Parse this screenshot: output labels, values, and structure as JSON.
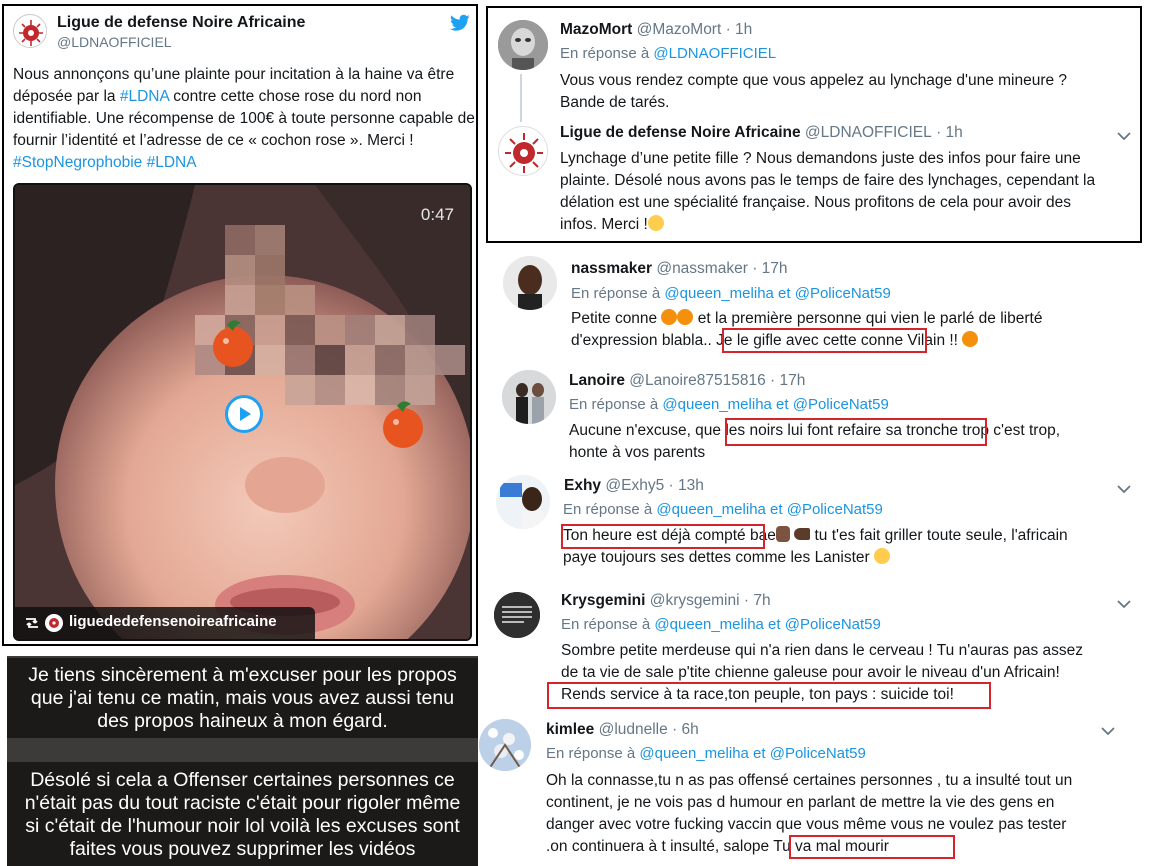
{
  "left_tweet": {
    "name": "Ligue de defense Noire Africaine",
    "handle": "@LDNAOFFICIEL",
    "text_part1": "Nous annonçons qu’une plainte pour incitation à la haine va être déposée par la ",
    "hashtag_ldna": "#LDNA",
    "text_part2": " contre cette chose rose du nord non identifiable. Une récompense de 100€ à toute personne capable de fournir l’identité et l’adresse de ce « cochon rose ». Merci !",
    "hashtags_end": "#StopNegrophobie #LDNA",
    "video_duration": "0:47",
    "video_account": "liguededefensenoireafricaine",
    "icon_bird": "twitter-bird-icon",
    "icon_retweet": "retweet-icon",
    "icon_play": "play-icon"
  },
  "apology": {
    "lines": [
      "Je tiens sincèrement à m'excuser pour les propos",
      "que j'ai tenu ce matin, mais vous avez aussi tenu",
      "des propos haineux à mon égard.",
      "Désolé si cela a Offenser certaines personnes ce",
      "n'était pas du tout raciste c'était pour rigoler même",
      "si c'était de l'humour noir lol voilà les excuses sont",
      "faites vous pouvez supprimer les vidéos"
    ]
  },
  "conversation": {
    "t1": {
      "name": "MazoMort",
      "handle": "@MazoMort",
      "time": "· 1h",
      "reply_prefix": "En réponse à ",
      "reply_to": "@LDNAOFFICIEL",
      "body_line1": "Vous vous rendez compte que vous appelez au lynchage d'une mineure ?",
      "body_line2": "Bande de tarés."
    },
    "t2": {
      "name": "Ligue de defense Noire Africaine",
      "handle": "@LDNAOFFICIEL",
      "time": "· 1h",
      "body_line1": "Lynchage d’une petite fille ? Nous demandons juste des infos pour faire une",
      "body_line2": "plainte. Désolé nous avons pas le temps de faire des lynchages, cependant la",
      "body_line3": "délation est une spécialité française. Nous profitons de cela pour avoir des",
      "body_line4": "infos. Merci !"
    }
  },
  "replies": [
    {
      "name": "nassmaker",
      "handle": "@nassmaker",
      "time": "· 17h",
      "reply_prefix": "En réponse à ",
      "reply_to_1": "@queen_meliha",
      "reply_and": " et ",
      "reply_to_2": "@PoliceNat59",
      "line1_a": "Petite conne ",
      "line1_b": " et la première personne qui vien le parlé de liberté",
      "line2_a": "d'expression blabla.. ",
      "line2_hl": "Je le gifle avec cette conne",
      "line2_b": " Vilain !! "
    },
    {
      "name": "Lanoire",
      "handle": "@Lanoire87515816",
      "time": "· 17h",
      "reply_prefix": "En réponse à ",
      "reply_to_1": "@queen_meliha",
      "reply_and": " et ",
      "reply_to_2": "@PoliceNat59",
      "line1_a": "Aucune n'excuse, que ",
      "line1_hl": "les noirs lui font refaire sa tronche",
      "line1_b": " trop c'est trop,",
      "line2": "honte à vos parents"
    },
    {
      "name": "Exhy",
      "handle": "@Exhy5",
      "time": "· 13h",
      "reply_prefix": "En réponse à ",
      "reply_to_1": "@queen_meliha",
      "reply_and": " et ",
      "reply_to_2": "@PoliceNat59",
      "line1_hl": "Ton heure est déjà compté",
      "line1_a": " bae",
      "line1_b": " tu t'es fait griller toute seule, l'africain",
      "line2": "paye toujours ses dettes comme les Lanister "
    },
    {
      "name": "Krysgemini",
      "handle": "@krysgemini",
      "time": "· 7h",
      "reply_prefix": "En réponse à ",
      "reply_to_1": "@queen_meliha",
      "reply_and": " et ",
      "reply_to_2": "@PoliceNat59",
      "line1": "Sombre petite merdeuse qui n'a rien dans le cerveau ! Tu n'auras pas assez",
      "line2": "de ta vie de sale p'tite chienne galeuse pour avoir le niveau d'un Africain!",
      "line3_hl": "Rends service à ta race,ton peuple, ton pays : suicide toi!"
    },
    {
      "name": "kimlee",
      "handle": "@ludnelle",
      "time": "· 6h",
      "reply_prefix": "En réponse à ",
      "reply_to_1": "@queen_meliha",
      "reply_and": " et ",
      "reply_to_2": "@PoliceNat59",
      "line1": "Oh la connasse,tu n as pas offensé certaines personnes , tu a insulté tout un",
      "line2": "continent,  je ne vois pas d humour en parlant de mettre la vie des gens en",
      "line3": "danger avec votre fucking vaccin que vous même vous ne voulez pas tester",
      "line4_a": ".on continuera à t insulté, salope ",
      "line4_hl": "Tu va mal mourir"
    }
  ],
  "colors": {
    "link": "#1b95e0",
    "muted": "#657786",
    "highlight_border": "#d3252b",
    "twitter_blue": "#1da1f2"
  }
}
